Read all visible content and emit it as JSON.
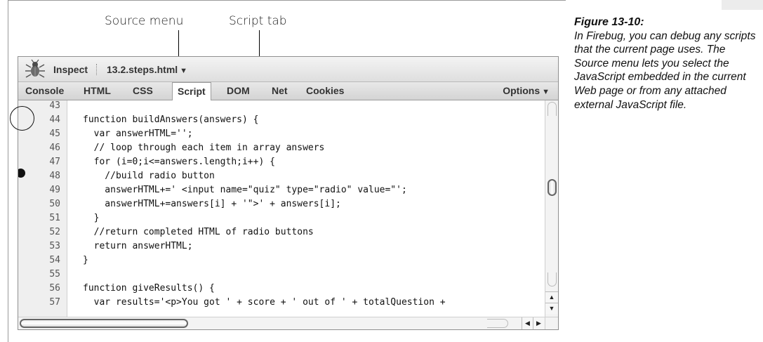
{
  "callouts": {
    "source_menu": "Source menu",
    "script_tab": "Script tab"
  },
  "caption": {
    "title": "Figure 13-10:",
    "body": "In Firebug, you can debug any scripts that the current page uses. The Source menu lets you select the JavaScript embedded in the current Web page or from any attached external JavaScript file."
  },
  "toolbar": {
    "logo_icon": "firebug-bug-icon",
    "inspect_label": "Inspect",
    "source_file": "13.2.steps.html",
    "source_arrow": "▼"
  },
  "tabs": [
    {
      "label": "Console"
    },
    {
      "label": "HTML"
    },
    {
      "label": "CSS"
    },
    {
      "label": "Script",
      "active": true
    },
    {
      "label": "DOM"
    },
    {
      "label": "Net"
    },
    {
      "label": "Cookies"
    }
  ],
  "options": {
    "label": "Options",
    "arrow": "▼"
  },
  "code_lines": [
    {
      "num": "43",
      "text": ""
    },
    {
      "num": "44",
      "text": "function buildAnswers(answers) {"
    },
    {
      "num": "45",
      "text": "  var answerHTML='';"
    },
    {
      "num": "46",
      "text": "  // loop through each item in array answers"
    },
    {
      "num": "47",
      "text": "  for (i=0;i<=answers.length;i++) {",
      "breakpoint": true
    },
    {
      "num": "48",
      "text": "    //build radio button"
    },
    {
      "num": "49",
      "text": "    answerHTML+=' <input name=\"quiz\" type=\"radio\" value=\"';"
    },
    {
      "num": "50",
      "text": "    answerHTML+=answers[i] + '\">' + answers[i];"
    },
    {
      "num": "51",
      "text": "  }"
    },
    {
      "num": "52",
      "text": "  //return completed HTML of radio buttons"
    },
    {
      "num": "53",
      "text": "  return answerHTML;"
    },
    {
      "num": "54",
      "text": "}"
    },
    {
      "num": "55",
      "text": ""
    },
    {
      "num": "56",
      "text": "function giveResults() {"
    },
    {
      "num": "57",
      "text": "  var results='<p>You got ' + score + ' out of ' + totalQuestion +"
    }
  ],
  "scrollbar": {
    "up_arrow": "▲",
    "down_arrow": "▼",
    "left_arrow": "◀",
    "right_arrow": "▶"
  }
}
